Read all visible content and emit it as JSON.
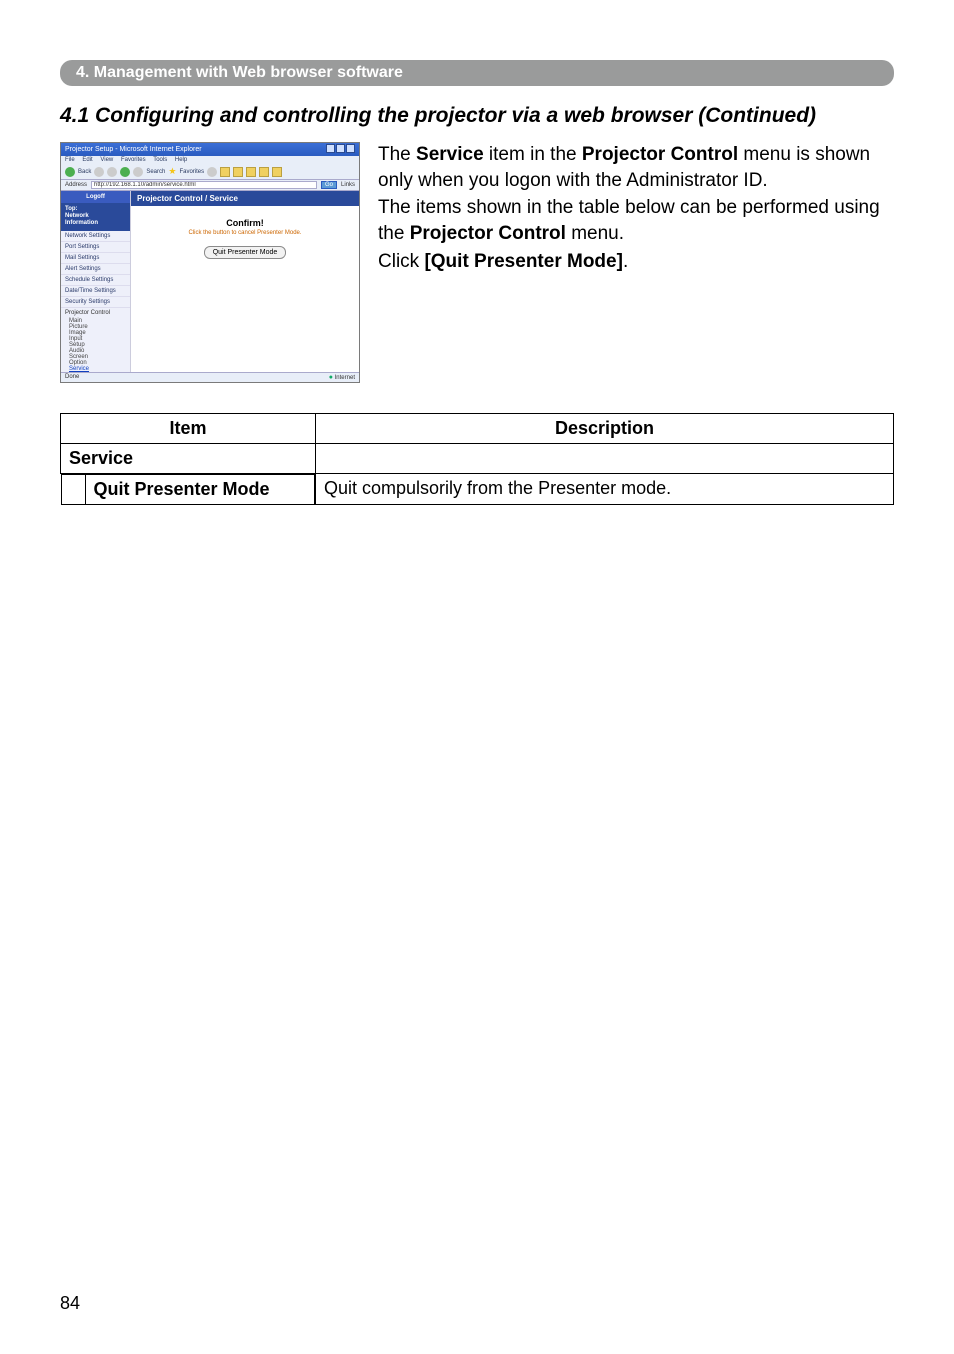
{
  "breadcrumb": "4. Management with Web browser software",
  "section_title": "4.1 Configuring and controlling the projector via a web browser (Continued)",
  "screenshot": {
    "window_title": "Projector Setup - Microsoft Internet Explorer",
    "menubar": {
      "file": "File",
      "edit": "Edit",
      "view": "View",
      "favorites": "Favorites",
      "tools": "Tools",
      "help": "Help"
    },
    "toolbar": {
      "back": "Back",
      "search": "Search",
      "favorites": "Favorites"
    },
    "addressbar": {
      "label": "Address",
      "url": "http://192.168.1.10/admin/service.html",
      "go": "Go",
      "links": "Links"
    },
    "sidebar": {
      "logoff": "Logoff",
      "top": "Top:\nNetwork\nInformation",
      "items": [
        "Network Settings",
        "Port Settings",
        "Mail Settings",
        "Alert Settings",
        "Schedule Settings",
        "Date/Time Settings",
        "Security Settings"
      ],
      "group_label": "Projector Control",
      "subs": [
        {
          "label": "Main",
          "current": false
        },
        {
          "label": "Picture",
          "current": false
        },
        {
          "label": "Image",
          "current": false
        },
        {
          "label": "Input",
          "current": false
        },
        {
          "label": "Setup",
          "current": false
        },
        {
          "label": "Audio",
          "current": false
        },
        {
          "label": "Screen",
          "current": false
        },
        {
          "label": "Option",
          "current": false
        },
        {
          "label": "Service",
          "current": true
        }
      ]
    },
    "panel": {
      "title": "Projector Control / Service",
      "confirm": "Confirm!",
      "warn": "Click the button to cancel Presenter Mode.",
      "button": "Quit Presenter Mode"
    },
    "statusbar": {
      "done": "Done",
      "zone": "Internet"
    }
  },
  "body_paragraphs": {
    "p1_prefix": "The ",
    "p1_bold1": "Service",
    "p1_mid": " item in the ",
    "p1_bold2": "Projector Control",
    "p1_suffix": " menu is shown only when you logon with the Administrator ID.",
    "p2_prefix": "The items shown in the table below can be performed using the ",
    "p2_bold": "Projector Control",
    "p2_suffix": " menu.",
    "p3_prefix": "Click ",
    "p3_bold": "[Quit Presenter Mode]",
    "p3_suffix": "."
  },
  "table": {
    "headers": {
      "item": "Item",
      "description": "Description"
    },
    "service_label": "Service",
    "rows": [
      {
        "item": "Quit Presenter Mode",
        "description": "Quit compulsorily from the Presenter mode."
      }
    ]
  },
  "page_number": "84"
}
